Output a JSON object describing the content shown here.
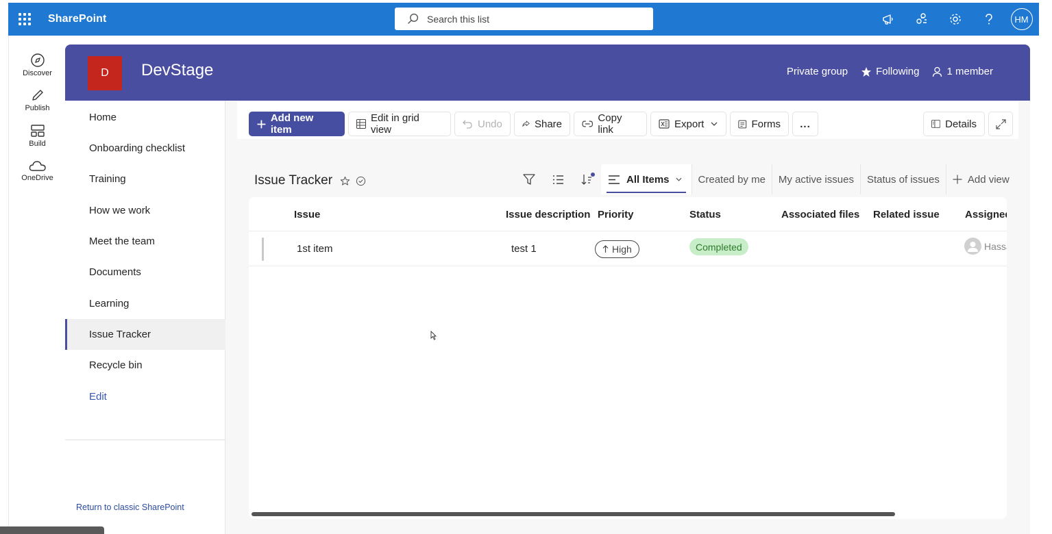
{
  "suite": {
    "brand": "SharePoint",
    "search_placeholder": "Search this list",
    "avatar_initials": "HM"
  },
  "appbar": [
    {
      "label": "Discover",
      "icon": "discover-icon"
    },
    {
      "label": "Publish",
      "icon": "publish-icon"
    },
    {
      "label": "Build",
      "icon": "build-icon"
    },
    {
      "label": "OneDrive",
      "icon": "onedrive-icon"
    }
  ],
  "site": {
    "logo_letter": "D",
    "title": "DevStage",
    "privacy": "Private group",
    "following": "Following",
    "members": "1 member",
    "colors": {
      "header": "#4a4ea0",
      "logo": "#c4261d",
      "suitebar": "#1f78d1"
    }
  },
  "nav": {
    "items": [
      "Home",
      "Onboarding checklist",
      "Training",
      "How we work",
      "Meet the team",
      "Documents",
      "Learning",
      "Issue Tracker",
      "Recycle bin"
    ],
    "selected": "Issue Tracker",
    "edit": "Edit",
    "classic": "Return to classic SharePoint"
  },
  "commands": {
    "add_new": "Add new item",
    "edit_grid": "Edit in grid view",
    "undo": "Undo",
    "share": "Share",
    "copy_link": "Copy link",
    "export": "Export",
    "forms": "Forms",
    "more": "...",
    "details": "Details"
  },
  "list": {
    "title": "Issue Tracker",
    "views": {
      "active": "All Items",
      "created_by_me": "Created by me",
      "my_active": "My active issues",
      "status": "Status of issues",
      "add_view": "Add view"
    },
    "columns": [
      "Issue",
      "Issue description",
      "Priority",
      "Status",
      "Associated files",
      "Related issue",
      "Assigned"
    ],
    "rows": [
      {
        "issue": "1st item",
        "description": "test 1",
        "priority": "High",
        "status": "Completed",
        "assigned": "Hassa"
      }
    ]
  }
}
